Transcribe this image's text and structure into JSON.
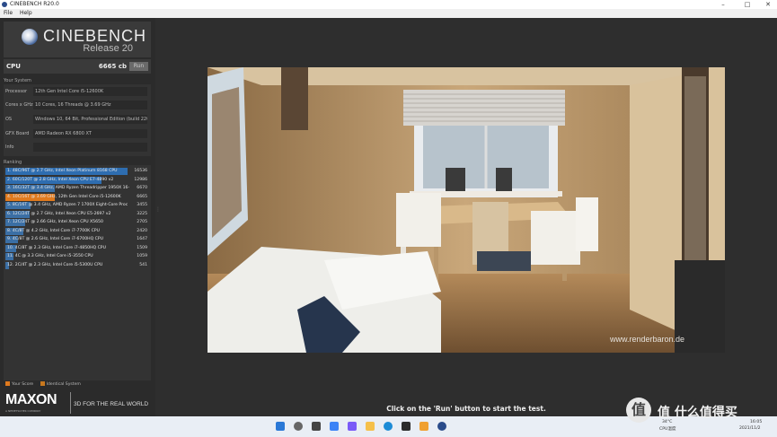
{
  "window": {
    "title": "CINEBENCH R20.0",
    "controls": {
      "minimize": "–",
      "maximize": "□",
      "close": "✕"
    }
  },
  "menu": {
    "items": [
      "File",
      "Help"
    ]
  },
  "logo": {
    "name": "CINEBENCH",
    "release": "Release 20"
  },
  "cpu": {
    "label": "CPU",
    "score": "6665 cb",
    "run_label": "Run"
  },
  "system": {
    "title": "Your System",
    "rows": [
      {
        "key": "Processor",
        "value": "12th Gen Intel Core i5-12600K"
      },
      {
        "key": "Cores x GHz",
        "value": "10 Cores, 16 Threads @ 3.69 GHz"
      },
      {
        "key": "OS",
        "value": "Windows 10, 64 Bit, Professional Edition (build 2200"
      },
      {
        "key": "GFX Board",
        "value": "AMD Radeon RX 6800 XT"
      },
      {
        "key": "Info",
        "value": ""
      }
    ]
  },
  "ranking": {
    "title": "Ranking",
    "rows": [
      {
        "text": "1. 48C/96T @ 2.7 GHz, Intel Xeon Platinum 8168 CPU",
        "score": "16536",
        "bar": 1.0,
        "color": "#2e6db0"
      },
      {
        "text": "2. 60C/120T @ 2.8 GHz, Intel Xeon CPU E7-4890 v2",
        "score": "12986",
        "bar": 0.785,
        "color": "#2e6db0"
      },
      {
        "text": "3. 16C/32T @ 3.4 GHz, AMD Ryzen Threadripper 1950X 16-",
        "score": "6670",
        "bar": 0.403,
        "color": "#3b6fa5"
      },
      {
        "text": "4. 10C/16T @ 3.69 GHz, 12th Gen Intel Core i5-12600K",
        "score": "6665",
        "bar": 0.403,
        "color": "#e07a1e"
      },
      {
        "text": "5. 8C/16T @ 3.4 GHz, AMD Ryzen 7 1700X Eight-Core Proc",
        "score": "3455",
        "bar": 0.209,
        "color": "#3b6fa5"
      },
      {
        "text": "6. 12C/24T @ 2.7 GHz, Intel Xeon CPU E5-2697 v2",
        "score": "3225",
        "bar": 0.195,
        "color": "#3b6fa5"
      },
      {
        "text": "7. 12C/24T @ 2.66 GHz, Intel Xeon CPU X5650",
        "score": "2705",
        "bar": 0.164,
        "color": "#3b6fa5"
      },
      {
        "text": "8. 4C/8T @ 4.2 GHz, Intel Core i7-7700K CPU",
        "score": "2420",
        "bar": 0.146,
        "color": "#3b6fa5"
      },
      {
        "text": "9. 4C/8T @ 2.6 GHz, Intel Core i7-6700HQ CPU",
        "score": "1647",
        "bar": 0.1,
        "color": "#3b6fa5"
      },
      {
        "text": "10. 4C/8T @ 2.3 GHz, Intel Core i7-4850HQ CPU",
        "score": "1509",
        "bar": 0.091,
        "color": "#3b6fa5"
      },
      {
        "text": "11. 4C @ 3.3 GHz, Intel Core i5-3550 CPU",
        "score": "1059",
        "bar": 0.064,
        "color": "#3b6fa5"
      },
      {
        "text": "12. 2C/4T @ 2.3 GHz, Intel Core i5-5300U CPU",
        "score": "541",
        "bar": 0.033,
        "color": "#3b6fa5"
      }
    ]
  },
  "legend": {
    "your_score": "Your Score",
    "identical": "Identical System",
    "your_color": "#e07a1e",
    "identical_color": "#c8781e"
  },
  "branding": {
    "maxon": "MAXON",
    "maxon_sub": "A NEMETSCHEK COMPANY",
    "tagline": "3D FOR THE REAL WORLD"
  },
  "render": {
    "watermark": "www.renderbaron.de"
  },
  "status": {
    "message": "Click on the 'Run' button to start the test."
  },
  "tray": {
    "weather": "34°C",
    "weather_sub": "CPU温度",
    "time": "16:05",
    "date": "2021/11/2"
  },
  "overlay": {
    "site": "值 什么值得买"
  }
}
